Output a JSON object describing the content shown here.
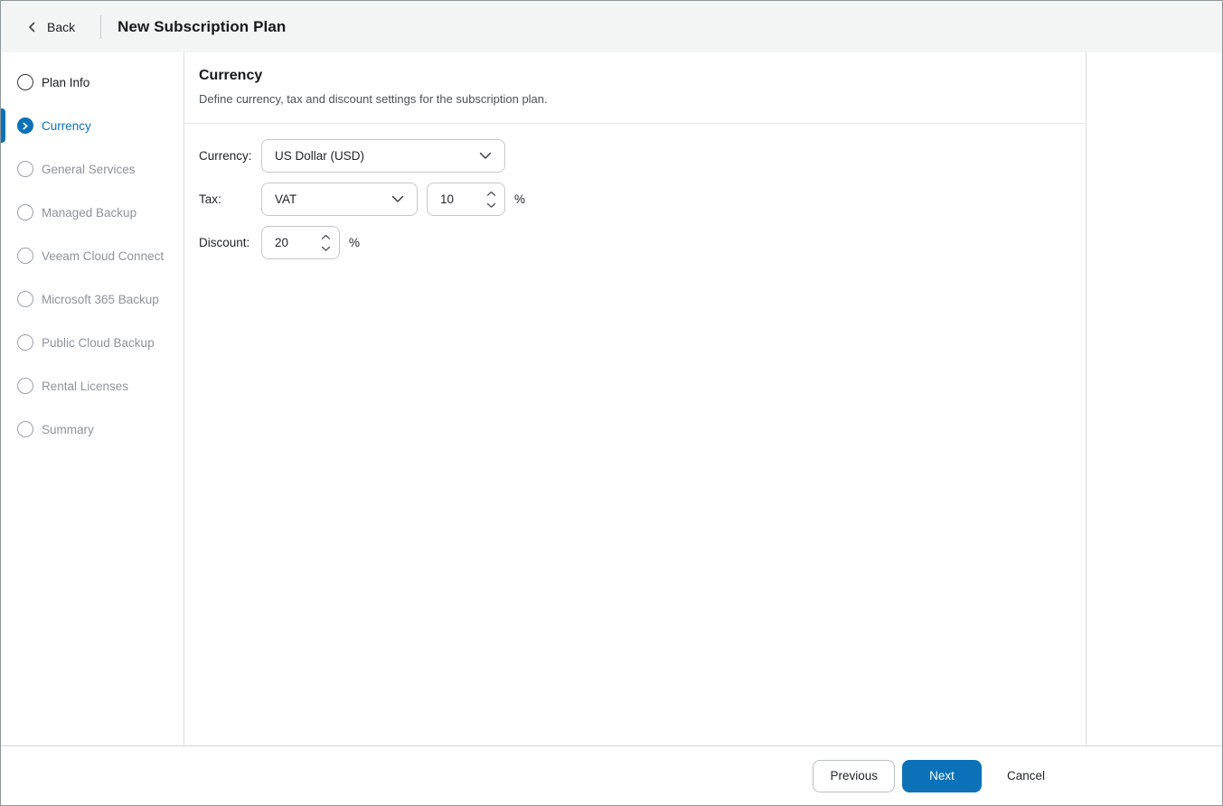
{
  "header": {
    "back_label": "Back",
    "title": "New Subscription Plan"
  },
  "sidebar": {
    "steps": [
      {
        "id": "plan-info",
        "label": "Plan Info",
        "state": "visited"
      },
      {
        "id": "currency",
        "label": "Currency",
        "state": "active"
      },
      {
        "id": "general-services",
        "label": "General Services",
        "state": "upcoming"
      },
      {
        "id": "managed-backup",
        "label": "Managed Backup",
        "state": "upcoming"
      },
      {
        "id": "veeam-cloud-connect",
        "label": "Veeam Cloud Connect",
        "state": "upcoming"
      },
      {
        "id": "microsoft-365-backup",
        "label": "Microsoft 365 Backup",
        "state": "upcoming"
      },
      {
        "id": "public-cloud-backup",
        "label": "Public Cloud Backup",
        "state": "upcoming"
      },
      {
        "id": "rental-licenses",
        "label": "Rental Licenses",
        "state": "upcoming"
      },
      {
        "id": "summary",
        "label": "Summary",
        "state": "upcoming"
      }
    ]
  },
  "content": {
    "heading": "Currency",
    "description": "Define currency, tax and discount settings for the subscription plan.",
    "fields": {
      "currency": {
        "label": "Currency:",
        "value": "US Dollar (USD)"
      },
      "tax": {
        "label": "Tax:",
        "type_value": "VAT",
        "rate_value": "10",
        "unit": "%"
      },
      "discount": {
        "label": "Discount:",
        "value": "20",
        "unit": "%"
      }
    }
  },
  "footer": {
    "previous_label": "Previous",
    "next_label": "Next",
    "cancel_label": "Cancel"
  },
  "colors": {
    "accent_blue": "#0b72b8",
    "header_background": "#f3f4f4",
    "inactive_step_gray": "#8d949d"
  }
}
